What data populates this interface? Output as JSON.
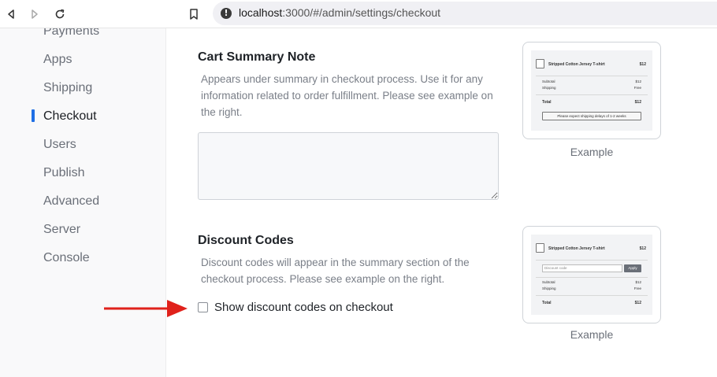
{
  "browser": {
    "url_host": "localhost",
    "url_rest": ":3000/#/admin/settings/checkout"
  },
  "sidebar": {
    "items": [
      {
        "label": "Payments"
      },
      {
        "label": "Apps"
      },
      {
        "label": "Shipping"
      },
      {
        "label": "Checkout"
      },
      {
        "label": "Users"
      },
      {
        "label": "Publish"
      },
      {
        "label": "Advanced"
      },
      {
        "label": "Server"
      },
      {
        "label": "Console"
      }
    ],
    "active": "Checkout"
  },
  "cart_note": {
    "title": "Cart Summary Note",
    "description": "Appears under summary in checkout process. Use it for any information related to order fulfillment. Please see example on the right.",
    "value": "",
    "example_caption": "Example",
    "preview": {
      "product": "Stripped Cotton Jersey T-shirt",
      "price": "$12",
      "subtotal_label": "Subtotal",
      "subtotal": "$12",
      "shipping_label": "Shipping",
      "shipping": "Free",
      "total_label": "Total",
      "total": "$12",
      "note": "Please expect shipping delays of 1-2 weeks"
    }
  },
  "discount": {
    "title": "Discount Codes",
    "description": "Discount codes will appear in the summary section of the checkout process. Please see example on the right.",
    "checkbox_label": "Show discount codes on checkout",
    "checked": false,
    "example_caption": "Example",
    "preview": {
      "product": "Stripped Cotton Jersey T-shirt",
      "price": "$12",
      "input_placeholder": "Discount code",
      "apply_label": "Apply",
      "subtotal_label": "Subtotal",
      "subtotal": "$12",
      "shipping_label": "Shipping",
      "shipping": "Free",
      "total_label": "Total",
      "total": "$12"
    }
  },
  "colors": {
    "accent": "#1f6fe5",
    "arrow": "#e0211b"
  }
}
